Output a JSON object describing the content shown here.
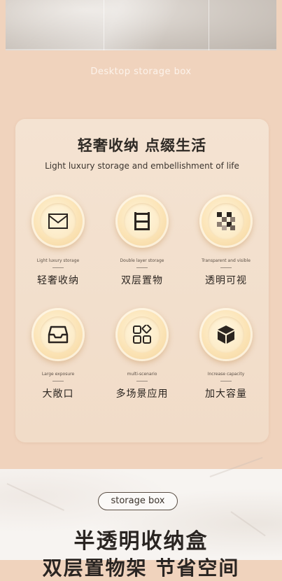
{
  "top_banner": {
    "caption": "Desktop storage box"
  },
  "feature_card": {
    "title": "轻奢收纳 点缀生活",
    "subtitle": "Light luxury storage and embellishment of life",
    "features": [
      {
        "en": "Light luxury storage",
        "cn": "轻奢收纳",
        "icon": "envelope-icon"
      },
      {
        "en": "Double layer storage",
        "cn": "双层置物",
        "icon": "double-shelf-icon"
      },
      {
        "en": "Transparent and visible",
        "cn": "透明可视",
        "icon": "checker-pattern-icon"
      },
      {
        "en": "Large exposure",
        "cn": "大敞口",
        "icon": "open-tray-icon"
      },
      {
        "en": "multi-scenario",
        "cn": "多场景应用",
        "icon": "grid-shapes-icon"
      },
      {
        "en": "Increase capacity",
        "cn": "加大容量",
        "icon": "cube-icon"
      }
    ]
  },
  "product_section": {
    "pill_label": "storage box",
    "title_line1": "半透明收纳盒",
    "title_line2": "双层置物架 节省空间"
  },
  "colors": {
    "background": "#f0d3bd",
    "card": "#f2dfcc",
    "icon_circle": "#fbe3b5",
    "text_dark": "#2b2520"
  }
}
